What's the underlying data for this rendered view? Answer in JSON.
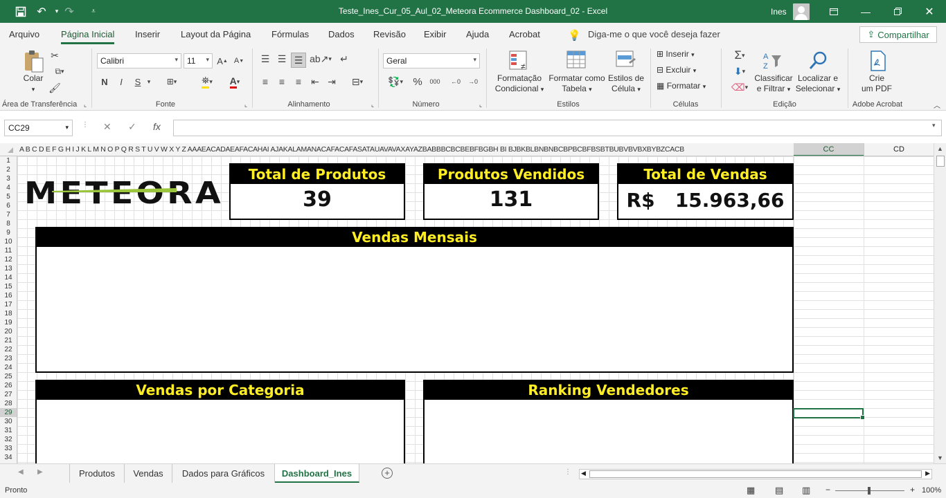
{
  "titlebar": {
    "title": "Teste_Ines_Cur_05_Aul_02_Meteora Ecommerce Dashboard_02  -  Excel",
    "user": "Ines"
  },
  "menu_tabs": [
    "Arquivo",
    "Página Inicial",
    "Inserir",
    "Layout da Página",
    "Fórmulas",
    "Dados",
    "Revisão",
    "Exibir",
    "Ajuda",
    "Acrobat"
  ],
  "tell_me": "Diga-me o que você deseja fazer",
  "share_label": "Compartilhar",
  "ribbon": {
    "clipboard": {
      "paste": "Colar",
      "label": "Área de Transferência"
    },
    "font": {
      "name": "Calibri",
      "size": "11",
      "bold": "N",
      "italic": "I",
      "underline": "S",
      "label": "Fonte"
    },
    "alignment": {
      "label": "Alinhamento"
    },
    "number": {
      "format": "Geral",
      "label": "Número"
    },
    "styles": {
      "conditional": [
        "Formatação",
        "Condicional"
      ],
      "as_table": [
        "Formatar como",
        "Tabela"
      ],
      "cell_styles": [
        "Estilos de",
        "Célula"
      ],
      "label": "Estilos"
    },
    "cells": {
      "insert": "Inserir",
      "delete": "Excluir",
      "format": "Formatar",
      "label": "Células"
    },
    "editing": {
      "sort": [
        "Classificar",
        "e Filtrar"
      ],
      "find": [
        "Localizar e",
        "Selecionar"
      ],
      "label": "Edição"
    },
    "acrobat": {
      "create": [
        "Crie",
        "um PDF"
      ],
      "label": "Adobe Acrobat"
    }
  },
  "formula_bar": {
    "name_box": "CC29",
    "formula": ""
  },
  "columns": {
    "narrow": "A  B  C  D  E  F  G  H  I  J  K  L  M N  O  P  Q  R  S  T  U  V  W  X  Y  Z AAAEACADAEAFACAHAI AJAKALAMANACAFACAFASATAUAVAVAXAYAZBABBBCBCBEBFBGBH BI BJBKBLBNBNBCBPBCBFBSBTBUBVBVBXBYBZCACB",
    "selected": "CC",
    "next": "CD"
  },
  "rows": [
    "1",
    "2",
    "3",
    "4",
    "5",
    "6",
    "7",
    "8",
    "9",
    "10",
    "11",
    "12",
    "13",
    "14",
    "15",
    "16",
    "17",
    "18",
    "19",
    "20",
    "21",
    "22",
    "23",
    "24",
    "25",
    "26",
    "27",
    "28",
    "29",
    "30",
    "31",
    "32",
    "33",
    "34"
  ],
  "selected_row": "29",
  "dashboard": {
    "logo": "METEORA",
    "kpis": [
      {
        "title": "Total de Produtos",
        "value": "39"
      },
      {
        "title": "Produtos Vendidos",
        "value": "131"
      },
      {
        "title": "Total de Vendas",
        "value": "R$   15.963,66"
      }
    ],
    "panels": {
      "monthly": "Vendas Mensais",
      "category": "Vendas por Categoria",
      "ranking": "Ranking Vendedores"
    }
  },
  "sheet_tabs": [
    "Produtos",
    "Vendas",
    "Dados para Gráficos",
    "Dashboard_Ines"
  ],
  "active_sheet": "Dashboard_Ines",
  "status": {
    "state": "Pronto",
    "zoom": "100%"
  },
  "colors": {
    "excel_green": "#217346",
    "card_header_bg": "#000000",
    "card_header_text": "#ffee24"
  }
}
